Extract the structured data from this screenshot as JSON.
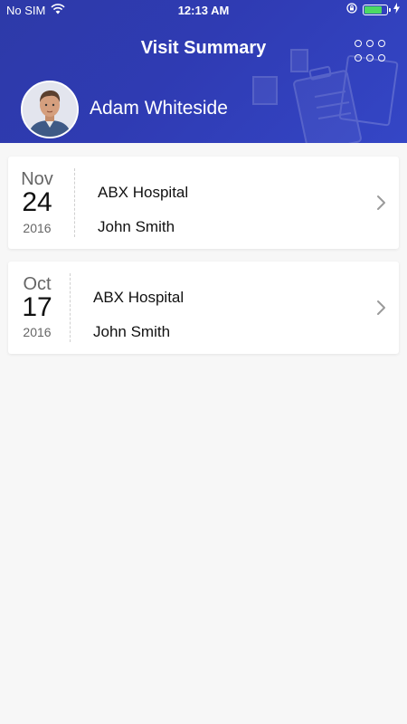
{
  "status_bar": {
    "carrier": "No SIM",
    "time": "12:13 AM",
    "battery_fill_fraction": 0.8
  },
  "header": {
    "title": "Visit Summary",
    "menu_icon": "grid-dots-icon"
  },
  "user": {
    "name": "Adam Whiteside",
    "avatar_icon": "profile-photo"
  },
  "visits": [
    {
      "month": "Nov",
      "day": "24",
      "year": "2016",
      "hospital": "ABX Hospital",
      "doctor": "John Smith"
    },
    {
      "month": "Oct",
      "day": "17",
      "year": "2016",
      "hospital": "ABX Hospital",
      "doctor": "John Smith"
    }
  ],
  "colors": {
    "header": "#2f3bb3",
    "background": "#f7f7f7",
    "battery": "#4cd964"
  }
}
